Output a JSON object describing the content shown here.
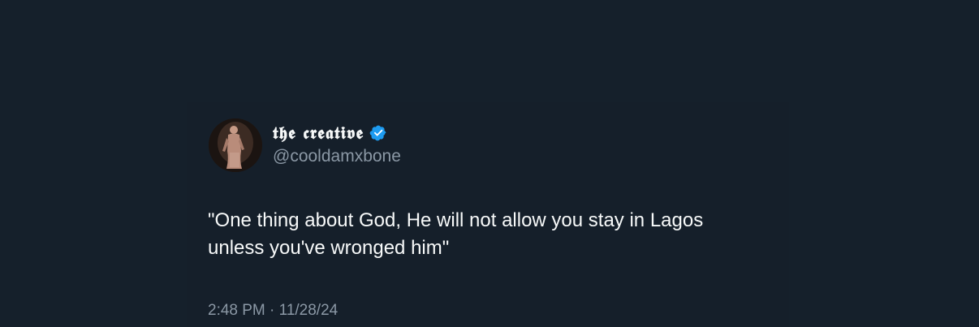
{
  "tweet": {
    "author": {
      "display_name": "𝖙𝖍𝖊 𝖈𝖗𝖊𝖆𝖙𝖎𝖛𝖊",
      "handle": "@cooldamxbone",
      "verified_badge_icon": "verified-badge-icon",
      "badge_color": "#1d9bf0"
    },
    "text_lines": [
      "\"One thing about God, He will not allow you stay in Lagos",
      "unless you've wronged him\""
    ],
    "time": "2:48 PM",
    "separator": "·",
    "date": "11/28/24"
  },
  "colors": {
    "background": "#15202b",
    "primary_text": "#f7f9f9",
    "secondary_text": "#8b98a5"
  }
}
